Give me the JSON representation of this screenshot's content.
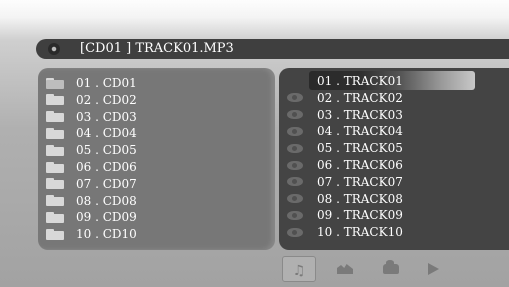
{
  "header": {
    "title": "[CD01 ] TRACK01.MP3",
    "icon": "disc-icon"
  },
  "folders": [
    {
      "label": "01 . CD01",
      "icon": "folder-open-icon"
    },
    {
      "label": "02 . CD02",
      "icon": "folder-icon"
    },
    {
      "label": "03 . CD03",
      "icon": "folder-icon"
    },
    {
      "label": "04 . CD04",
      "icon": "folder-icon"
    },
    {
      "label": "05 . CD05",
      "icon": "folder-icon"
    },
    {
      "label": "06 . CD06",
      "icon": "folder-icon"
    },
    {
      "label": "07 . CD07",
      "icon": "folder-icon"
    },
    {
      "label": "08 . CD08",
      "icon": "folder-icon"
    },
    {
      "label": "09 . CD09",
      "icon": "folder-icon"
    },
    {
      "label": "10 . CD10",
      "icon": "folder-icon"
    }
  ],
  "tracks": [
    {
      "label": "01 . TRACK01",
      "selected": true
    },
    {
      "label": "02 . TRACK02"
    },
    {
      "label": "03 . TRACK03"
    },
    {
      "label": "04 . TRACK04"
    },
    {
      "label": "05 . TRACK05"
    },
    {
      "label": "06 . TRACK06"
    },
    {
      "label": "07 . TRACK07"
    },
    {
      "label": "08 . TRACK08"
    },
    {
      "label": "09 . TRACK09"
    },
    {
      "label": "10 . TRACK10"
    }
  ],
  "bottom_bar": {
    "buttons": [
      {
        "name": "music-filter-button",
        "icon": "music-note-icon",
        "active": true
      },
      {
        "name": "photo-filter-button",
        "icon": "photo-icon",
        "active": false
      },
      {
        "name": "video-filter-button",
        "icon": "video-icon",
        "active": false
      },
      {
        "name": "play-button",
        "icon": "play-icon",
        "active": false
      }
    ]
  },
  "colors": {
    "title_bar": "#3f3f3f",
    "left_panel": "#777777",
    "right_panel": "#444444",
    "text": "#ffffff"
  }
}
